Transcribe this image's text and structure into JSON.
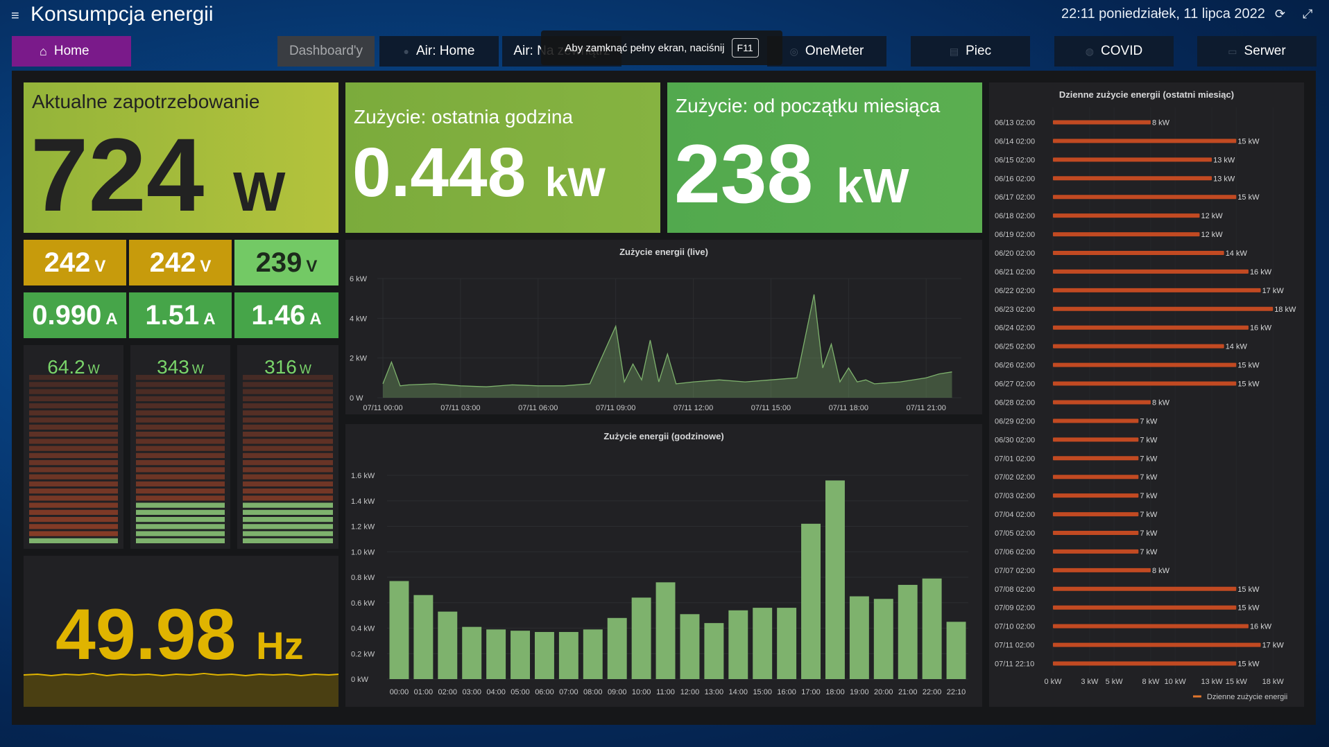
{
  "header": {
    "title": "Konsumpcja energii",
    "datetime": "22:11 poniedziałek, 11 lipca 2022"
  },
  "nav": {
    "home": "Home",
    "dashboards": "Dashboard'y",
    "air_home": "Air: Home",
    "air_outside": "Air: Na zewnątrz",
    "onemeter": "OneMeter",
    "piec": "Piec",
    "covid": "COVID",
    "serwer": "Serwer"
  },
  "toast": {
    "text": "Aby zamknąć pełny ekran, naciśnij",
    "key": "F11"
  },
  "current_demand": {
    "title": "Aktualne zapotrzebowanie",
    "value": "724",
    "unit": "W"
  },
  "last_hour": {
    "title": "Zużycie: ostatnia godzina",
    "value": "0.448",
    "unit": "kW"
  },
  "month": {
    "title": "Zużycie: od początku miesiąca",
    "value": "238",
    "unit": "kW"
  },
  "voltages": [
    {
      "value": "242",
      "unit": "V",
      "color": "#c79b0c"
    },
    {
      "value": "242",
      "unit": "V",
      "color": "#c79b0c"
    },
    {
      "value": "239",
      "unit": "V",
      "color": "#5ec35a"
    }
  ],
  "currents": [
    {
      "value": "0.990",
      "unit": "A",
      "color": "#3fa64a"
    },
    {
      "value": "1.51",
      "unit": "A",
      "color": "#3fa64a"
    },
    {
      "value": "1.46",
      "unit": "A",
      "color": "#3fa64a"
    }
  ],
  "phase_power": [
    {
      "value": "64.2",
      "unit": "W",
      "level": 0.05
    },
    {
      "value": "343",
      "unit": "W",
      "level": 0.24
    },
    {
      "value": "316",
      "unit": "W",
      "level": 0.24
    }
  ],
  "frequency": {
    "value": "49.98",
    "unit": "Hz"
  },
  "colors": {
    "accent_yellow": "#e0b400",
    "bar_green": "#7eb26d",
    "bar_orange": "#e0752d"
  },
  "chart_data": [
    {
      "type": "area",
      "title": "Zużycie energii (live)",
      "y_ticks": [
        "0 W",
        "2 kW",
        "4 kW",
        "6 kW"
      ],
      "ylim": [
        0,
        6000
      ],
      "x_ticks": [
        "07/11 00:00",
        "07/11 03:00",
        "07/11 06:00",
        "07/11 09:00",
        "07/11 12:00",
        "07/11 15:00",
        "07/11 18:00",
        "07/11 21:00"
      ],
      "x": [
        "07/11 00:00",
        "07/11 00:20",
        "07/11 00:40",
        "07/11 01:00",
        "07/11 02:00",
        "07/11 03:00",
        "07/11 04:00",
        "07/11 05:00",
        "07/11 06:00",
        "07/11 07:00",
        "07/11 08:00",
        "07/11 09:00",
        "07/11 09:20",
        "07/11 09:40",
        "07/11 10:00",
        "07/11 10:20",
        "07/11 10:40",
        "07/11 11:00",
        "07/11 11:20",
        "07/11 12:00",
        "07/11 13:00",
        "07/11 14:00",
        "07/11 15:00",
        "07/11 16:00",
        "07/11 16:40",
        "07/11 17:00",
        "07/11 17:20",
        "07/11 17:40",
        "07/11 18:00",
        "07/11 18:20",
        "07/11 18:40",
        "07/11 19:00",
        "07/11 20:00",
        "07/11 21:00",
        "07/11 21:30",
        "07/11 22:00"
      ],
      "values": [
        700,
        1800,
        600,
        650,
        700,
        600,
        550,
        650,
        600,
        600,
        700,
        3600,
        800,
        1700,
        900,
        2900,
        800,
        2200,
        700,
        800,
        900,
        800,
        900,
        1000,
        5200,
        1500,
        2700,
        800,
        1500,
        800,
        900,
        700,
        800,
        1000,
        1200,
        1300
      ],
      "grid": true
    },
    {
      "type": "bar",
      "title": "Zużycie energii (godzinowe)",
      "y_ticks": [
        "0 kW",
        "0.2 kW",
        "0.4 kW",
        "0.6 kW",
        "0.8 kW",
        "1.0 kW",
        "1.2 kW",
        "1.4 kW",
        "1.6 kW"
      ],
      "ylim": [
        0,
        1.6
      ],
      "categories": [
        "00:00",
        "01:00",
        "02:00",
        "03:00",
        "04:00",
        "05:00",
        "06:00",
        "07:00",
        "08:00",
        "09:00",
        "10:00",
        "11:00",
        "12:00",
        "13:00",
        "14:00",
        "15:00",
        "16:00",
        "17:00",
        "18:00",
        "19:00",
        "20:00",
        "21:00",
        "22:00",
        "22:10"
      ],
      "values": [
        0.77,
        0.66,
        0.53,
        0.41,
        0.39,
        0.38,
        0.37,
        0.37,
        0.39,
        0.48,
        0.64,
        0.76,
        0.51,
        0.44,
        0.54,
        0.56,
        0.56,
        1.22,
        1.56,
        0.65,
        0.63,
        0.74,
        0.79,
        0.45
      ],
      "grid": true
    },
    {
      "type": "bar",
      "title": "Dzienne zużycie energii (ostatni miesiąc)",
      "orientation": "horizontal",
      "categories": [
        "06/13 02:00",
        "06/14 02:00",
        "06/15 02:00",
        "06/16 02:00",
        "06/17 02:00",
        "06/18 02:00",
        "06/19 02:00",
        "06/20 02:00",
        "06/21 02:00",
        "06/22 02:00",
        "06/23 02:00",
        "06/24 02:00",
        "06/25 02:00",
        "06/26 02:00",
        "06/27 02:00",
        "06/28 02:00",
        "06/29 02:00",
        "06/30 02:00",
        "07/01 02:00",
        "07/02 02:00",
        "07/03 02:00",
        "07/04 02:00",
        "07/05 02:00",
        "07/06 02:00",
        "07/07 02:00",
        "07/08 02:00",
        "07/09 02:00",
        "07/10 02:00",
        "07/11 02:00",
        "07/11 22:10"
      ],
      "values": [
        8,
        15,
        13,
        13,
        15,
        12,
        12,
        14,
        16,
        17,
        18,
        16,
        14,
        15,
        15,
        8,
        7,
        7,
        7,
        7,
        7,
        7,
        7,
        7,
        8,
        15,
        15,
        16,
        17,
        15
      ],
      "labels": [
        "8 kW",
        "15 kW",
        "13 kW",
        "13 kW",
        "15 kW",
        "12 kW",
        "12 kW",
        "14 kW",
        "16 kW",
        "17 kW",
        "18 kW",
        "16 kW",
        "14 kW",
        "15 kW",
        "15 kW",
        "8 kW",
        "7 kW",
        "7 kW",
        "7 kW",
        "7 kW",
        "7 kW",
        "7 kW",
        "7 kW",
        "7 kW",
        "8 kW",
        "15 kW",
        "15 kW",
        "16 kW",
        "17 kW",
        "15 kW"
      ],
      "x_ticks": [
        "0 kW",
        "3 kW",
        "5 kW",
        "8 kW",
        "10 kW",
        "13 kW",
        "15 kW",
        "18 kW"
      ],
      "xlim": [
        0,
        18.5
      ],
      "series": [
        {
          "name": "Dzienne zużycie energii"
        }
      ],
      "legend": "bottom-right"
    }
  ]
}
